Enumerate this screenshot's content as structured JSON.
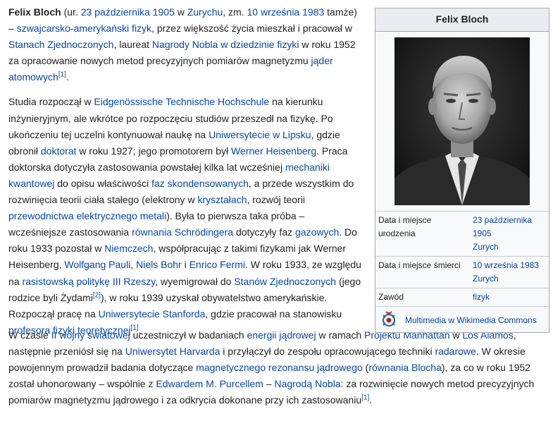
{
  "article": {
    "p1": {
      "name": "Felix Bloch",
      "t1": " (ur. ",
      "l_birthdate": "23 października 1905",
      "t2": " w ",
      "l_zurich": "Zurychu",
      "t3": ", zm. ",
      "l_deathdate": "10 września 1983",
      "t4": " tamże) – ",
      "l_physicist": "szwajcarsko-amerykański fizyk",
      "t5": ", przez większość życia mieszkał i pracował w ",
      "l_usa": "Stanach Zjednoczonych",
      "t6": ", laureat ",
      "l_nobel": "Nagrody Nobla w dziedzinie fizyki",
      "t7": " w roku 1952 za opracowanie nowych metod precyzyjnych pomiarów magnetyzmu ",
      "l_nuclei": "jąder atomowych",
      "ref": "[1]",
      "t8": "."
    },
    "p2": {
      "t1": "Studia rozpoczął w ",
      "l_eth": "Eidgenössische Technische Hochschule",
      "t2": " na kierunku inżynieryjnym, ale wkrótce po rozpoczęciu studiów przeszedł na fizykę. Po ukończeniu tej uczelni kontynuował naukę na ",
      "l_leipzig": "Uniwersytecie w Lipsku",
      "t3": ", gdzie obronił ",
      "l_doctorate": "doktorat",
      "t4": " w roku 1927; jego promotorem był ",
      "l_heisenberg": "Werner Heisenberg",
      "t5": ". Praca doktorska dotyczyła zastosowania powstałej kilka lat wcześniej ",
      "l_qm": "mechaniki kwantowej",
      "t6": " do opisu właściwości ",
      "l_condensed": "faz skondensowanych",
      "t7": ", a przede wszystkim do rozwinięcia teorii ciała stałego (elektrony w ",
      "l_crystals": "kryształach",
      "t8": ", rozwój teorii ",
      "l_conductivity": "przewodnictwa elektrycznego metali",
      "t9": "). Była to pierwsza taka próba – wcześniejsze zastosowania ",
      "l_schrodinger": "równania Schrödingera",
      "t10": " dotyczyły faz ",
      "l_gas": "gazowych",
      "t11": ". Do roku 1933 pozostał w ",
      "l_germany": "Niemczech",
      "t12": ", współpracując z takimi fizykami jak Werner Heisenberg, ",
      "l_pauli": "Wolfgang Pauli",
      "t13": ", ",
      "l_bohr": "Niels Bohr",
      "t14": " i ",
      "l_fermi": "Enrico Fermi",
      "t15": ". W roku 1933, ze względu na ",
      "l_racist": "rasistowską politykę III Rzeszy",
      "t16": ", wyemigrował do ",
      "l_usa2": "Stanów Zjednoczonych",
      "t17": " (jego rodzice byli Żydami",
      "ref2": "[2]",
      "t18": "), w roku 1939 uzyskał obywatelstwo amerykańskie. Rozpoczął pracę na ",
      "l_stanford": "Uniwersytecie Stanforda",
      "t19": ", gdzie pracował na stanowisku ",
      "l_professor": "profesora fizyki teoretycznej",
      "ref1": "[1]",
      "t20": "."
    },
    "p3": {
      "t1": "W czasie ",
      "l_ww2": "II wojny światowej",
      "t2": " uczestniczył w badaniach ",
      "l_nuclear": "energii jądrowej",
      "t3": " w ramach ",
      "l_manhattan": "Projektu Manhattan",
      "t4": " w ",
      "l_losalamos": "Los Alamos",
      "t5": ", następnie przeniósł się na ",
      "l_harvard": "Uniwersytet Harvarda",
      "t6": " i przyłączył do zespołu opracowującego techniki ",
      "l_radar": "radarowe",
      "t7": ". W okresie powojennym prowadził badania dotyczące ",
      "l_nmr": "magnetycznego rezonansu jądrowego",
      "t8": " (",
      "l_bloch_eq": "równania Blocha",
      "t9": "), za co w roku 1952 został uhonorowany – wspólnie z ",
      "l_purcell": "Edwardem M. Purcellem",
      "t10": " – ",
      "l_nobel2": "Nagrodą Nobla",
      "t11": ": za rozwinięcie nowych metod precyzyjnych pomiarów magnetyzmu jądrowego i za odkrycia dokonane przy ich zastosowaniu",
      "ref": "[1]",
      "t12": "."
    }
  },
  "infobox": {
    "title": "Felix Bloch",
    "birth_label": "Data i miejsce urodzenia",
    "birth_date": "23 października 1905",
    "birth_place": "Zurych",
    "death_label": "Data i miejsce śmierci",
    "death_date": "10 września 1983",
    "death_place": "Zurych",
    "occupation_label": "Zawód",
    "occupation": "fizyk",
    "commons": "Multimedia w Wikimedia Commons",
    "commons_icon": "wikimedia-commons-icon",
    "colors": {
      "link": "#0645ad",
      "text": "#202122",
      "header_bg": "#eaecf0",
      "box_bg": "#f8f9fa",
      "border": "#a2a9b1"
    }
  }
}
